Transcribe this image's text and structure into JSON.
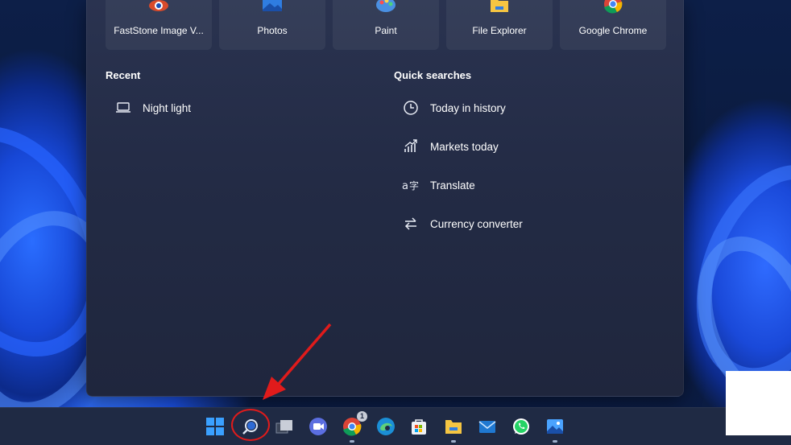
{
  "pinned_apps": [
    {
      "label": "FastStone Image V...",
      "icon": "faststone-icon"
    },
    {
      "label": "Photos",
      "icon": "photos-icon"
    },
    {
      "label": "Paint",
      "icon": "paint-icon"
    },
    {
      "label": "File Explorer",
      "icon": "folder-icon"
    },
    {
      "label": "Google Chrome",
      "icon": "chrome-icon"
    }
  ],
  "recent": {
    "title": "Recent",
    "items": [
      {
        "label": "Night light",
        "icon": "laptop-icon"
      }
    ]
  },
  "quick_searches": {
    "title": "Quick searches",
    "items": [
      {
        "label": "Today in history",
        "icon": "clock-icon"
      },
      {
        "label": "Markets today",
        "icon": "chart-icon"
      },
      {
        "label": "Translate",
        "icon": "translate-icon"
      },
      {
        "label": "Currency converter",
        "icon": "swap-icon"
      }
    ]
  },
  "taskbar": {
    "items": [
      "start-icon",
      "search-icon",
      "task-view-icon",
      "video-call-icon",
      "chrome-icon",
      "edge-icon",
      "store-icon",
      "file-explorer-icon",
      "mail-icon",
      "whatsapp-icon",
      "photos-icon"
    ],
    "badge": "1"
  },
  "colors": {
    "annotation": "#e01b1b",
    "accent": "#0a84ff"
  }
}
